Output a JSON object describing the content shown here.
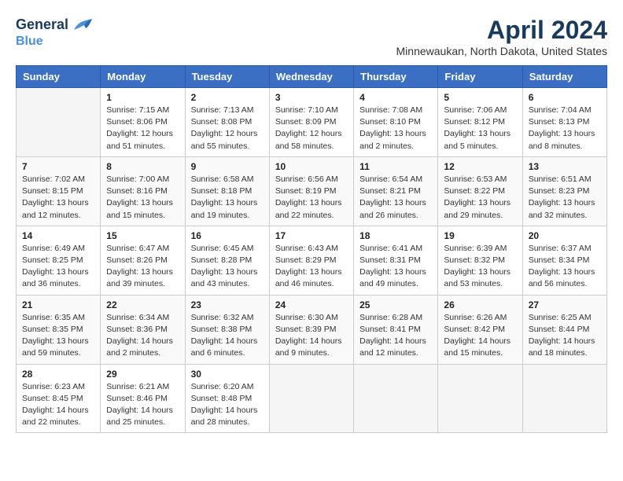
{
  "header": {
    "logo_line1": "General",
    "logo_line2": "Blue",
    "main_title": "April 2024",
    "subtitle": "Minnewaukan, North Dakota, United States"
  },
  "calendar": {
    "days_of_week": [
      "Sunday",
      "Monday",
      "Tuesday",
      "Wednesday",
      "Thursday",
      "Friday",
      "Saturday"
    ],
    "weeks": [
      [
        {
          "day": "",
          "sunrise": "",
          "sunset": "",
          "daylight": ""
        },
        {
          "day": "1",
          "sunrise": "Sunrise: 7:15 AM",
          "sunset": "Sunset: 8:06 PM",
          "daylight": "Daylight: 12 hours and 51 minutes."
        },
        {
          "day": "2",
          "sunrise": "Sunrise: 7:13 AM",
          "sunset": "Sunset: 8:08 PM",
          "daylight": "Daylight: 12 hours and 55 minutes."
        },
        {
          "day": "3",
          "sunrise": "Sunrise: 7:10 AM",
          "sunset": "Sunset: 8:09 PM",
          "daylight": "Daylight: 12 hours and 58 minutes."
        },
        {
          "day": "4",
          "sunrise": "Sunrise: 7:08 AM",
          "sunset": "Sunset: 8:10 PM",
          "daylight": "Daylight: 13 hours and 2 minutes."
        },
        {
          "day": "5",
          "sunrise": "Sunrise: 7:06 AM",
          "sunset": "Sunset: 8:12 PM",
          "daylight": "Daylight: 13 hours and 5 minutes."
        },
        {
          "day": "6",
          "sunrise": "Sunrise: 7:04 AM",
          "sunset": "Sunset: 8:13 PM",
          "daylight": "Daylight: 13 hours and 8 minutes."
        }
      ],
      [
        {
          "day": "7",
          "sunrise": "Sunrise: 7:02 AM",
          "sunset": "Sunset: 8:15 PM",
          "daylight": "Daylight: 13 hours and 12 minutes."
        },
        {
          "day": "8",
          "sunrise": "Sunrise: 7:00 AM",
          "sunset": "Sunset: 8:16 PM",
          "daylight": "Daylight: 13 hours and 15 minutes."
        },
        {
          "day": "9",
          "sunrise": "Sunrise: 6:58 AM",
          "sunset": "Sunset: 8:18 PM",
          "daylight": "Daylight: 13 hours and 19 minutes."
        },
        {
          "day": "10",
          "sunrise": "Sunrise: 6:56 AM",
          "sunset": "Sunset: 8:19 PM",
          "daylight": "Daylight: 13 hours and 22 minutes."
        },
        {
          "day": "11",
          "sunrise": "Sunrise: 6:54 AM",
          "sunset": "Sunset: 8:21 PM",
          "daylight": "Daylight: 13 hours and 26 minutes."
        },
        {
          "day": "12",
          "sunrise": "Sunrise: 6:53 AM",
          "sunset": "Sunset: 8:22 PM",
          "daylight": "Daylight: 13 hours and 29 minutes."
        },
        {
          "day": "13",
          "sunrise": "Sunrise: 6:51 AM",
          "sunset": "Sunset: 8:23 PM",
          "daylight": "Daylight: 13 hours and 32 minutes."
        }
      ],
      [
        {
          "day": "14",
          "sunrise": "Sunrise: 6:49 AM",
          "sunset": "Sunset: 8:25 PM",
          "daylight": "Daylight: 13 hours and 36 minutes."
        },
        {
          "day": "15",
          "sunrise": "Sunrise: 6:47 AM",
          "sunset": "Sunset: 8:26 PM",
          "daylight": "Daylight: 13 hours and 39 minutes."
        },
        {
          "day": "16",
          "sunrise": "Sunrise: 6:45 AM",
          "sunset": "Sunset: 8:28 PM",
          "daylight": "Daylight: 13 hours and 43 minutes."
        },
        {
          "day": "17",
          "sunrise": "Sunrise: 6:43 AM",
          "sunset": "Sunset: 8:29 PM",
          "daylight": "Daylight: 13 hours and 46 minutes."
        },
        {
          "day": "18",
          "sunrise": "Sunrise: 6:41 AM",
          "sunset": "Sunset: 8:31 PM",
          "daylight": "Daylight: 13 hours and 49 minutes."
        },
        {
          "day": "19",
          "sunrise": "Sunrise: 6:39 AM",
          "sunset": "Sunset: 8:32 PM",
          "daylight": "Daylight: 13 hours and 53 minutes."
        },
        {
          "day": "20",
          "sunrise": "Sunrise: 6:37 AM",
          "sunset": "Sunset: 8:34 PM",
          "daylight": "Daylight: 13 hours and 56 minutes."
        }
      ],
      [
        {
          "day": "21",
          "sunrise": "Sunrise: 6:35 AM",
          "sunset": "Sunset: 8:35 PM",
          "daylight": "Daylight: 13 hours and 59 minutes."
        },
        {
          "day": "22",
          "sunrise": "Sunrise: 6:34 AM",
          "sunset": "Sunset: 8:36 PM",
          "daylight": "Daylight: 14 hours and 2 minutes."
        },
        {
          "day": "23",
          "sunrise": "Sunrise: 6:32 AM",
          "sunset": "Sunset: 8:38 PM",
          "daylight": "Daylight: 14 hours and 6 minutes."
        },
        {
          "day": "24",
          "sunrise": "Sunrise: 6:30 AM",
          "sunset": "Sunset: 8:39 PM",
          "daylight": "Daylight: 14 hours and 9 minutes."
        },
        {
          "day": "25",
          "sunrise": "Sunrise: 6:28 AM",
          "sunset": "Sunset: 8:41 PM",
          "daylight": "Daylight: 14 hours and 12 minutes."
        },
        {
          "day": "26",
          "sunrise": "Sunrise: 6:26 AM",
          "sunset": "Sunset: 8:42 PM",
          "daylight": "Daylight: 14 hours and 15 minutes."
        },
        {
          "day": "27",
          "sunrise": "Sunrise: 6:25 AM",
          "sunset": "Sunset: 8:44 PM",
          "daylight": "Daylight: 14 hours and 18 minutes."
        }
      ],
      [
        {
          "day": "28",
          "sunrise": "Sunrise: 6:23 AM",
          "sunset": "Sunset: 8:45 PM",
          "daylight": "Daylight: 14 hours and 22 minutes."
        },
        {
          "day": "29",
          "sunrise": "Sunrise: 6:21 AM",
          "sunset": "Sunset: 8:46 PM",
          "daylight": "Daylight: 14 hours and 25 minutes."
        },
        {
          "day": "30",
          "sunrise": "Sunrise: 6:20 AM",
          "sunset": "Sunset: 8:48 PM",
          "daylight": "Daylight: 14 hours and 28 minutes."
        },
        {
          "day": "",
          "sunrise": "",
          "sunset": "",
          "daylight": ""
        },
        {
          "day": "",
          "sunrise": "",
          "sunset": "",
          "daylight": ""
        },
        {
          "day": "",
          "sunrise": "",
          "sunset": "",
          "daylight": ""
        },
        {
          "day": "",
          "sunrise": "",
          "sunset": "",
          "daylight": ""
        }
      ]
    ]
  }
}
